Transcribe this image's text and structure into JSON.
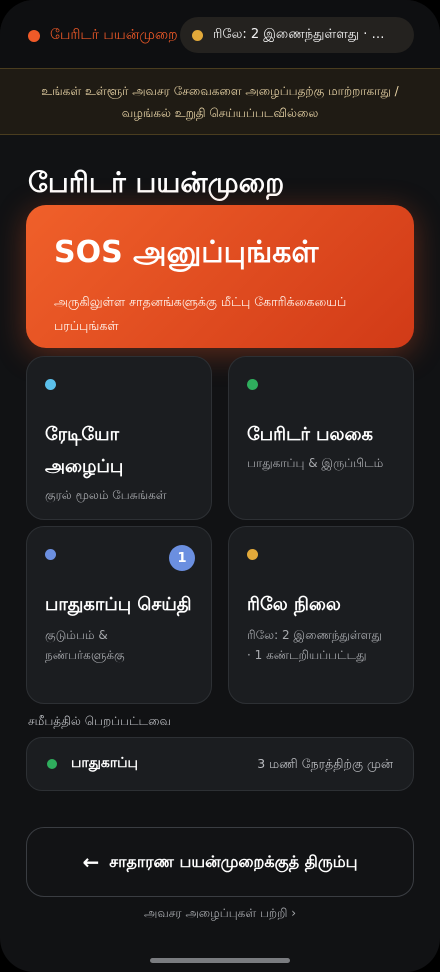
{
  "header": {
    "mode_label": "பேரிடர் பயன்முறை",
    "relay_status": "ரிலே: 2 இணைந்துள்ளது · …"
  },
  "banner": {
    "warning": "உங்கள் உள்ளூர் அவசர சேவைகளை அழைப்பதற்கு மாற்றாகாது / வழங்கல் உறுதி செய்யப்படவில்லை"
  },
  "page": {
    "title": "பேரிடர் பயன்முறை"
  },
  "sos": {
    "title": "SOS அனுப்புங்கள்",
    "subtitle": "அருகிலுள்ள சாதனங்களுக்கு மீட்பு கோரிக்கையைப் பரப்புங்கள்"
  },
  "cards": {
    "radio": {
      "title": "ரேடியோ அழைப்பு",
      "subtitle": "குரல் மூலம் பேசுங்கள்"
    },
    "board": {
      "title": "பேரிடர் பலகை",
      "subtitle": "பாதுகாப்பு & இருப்பிடம்"
    },
    "safety": {
      "title": "பாதுகாப்பு செய்தி",
      "subtitle": "குடும்பம் & நண்பர்களுக்கு",
      "badge": "1"
    },
    "relay": {
      "title": "ரிலே நிலை",
      "subtitle": "ரிலே: 2 இணைந்துள்ளது · 1 கண்டறியப்பட்டது"
    }
  },
  "recent": {
    "label": "சமீபத்தில் பெறப்பட்டவை",
    "item_label": "பாதுகாப்பு",
    "item_time": "3 மணி நேரத்திற்கு முன்"
  },
  "footer": {
    "back_arrow": "←",
    "back_label": "சாதாரண பயன்முறைக்குத் திரும்பு",
    "about": "அவசர அழைப்புகள் பற்றி ›"
  },
  "colors": {
    "accent": "#f05a28",
    "relay_dot": "#e2a93a",
    "radio_dot": "#5bc0eb",
    "board_dot": "#2fae5d",
    "safety_dot": "#6b8fe0",
    "relay_card_dot": "#e2a93a",
    "recent_dot": "#2fae5d"
  }
}
